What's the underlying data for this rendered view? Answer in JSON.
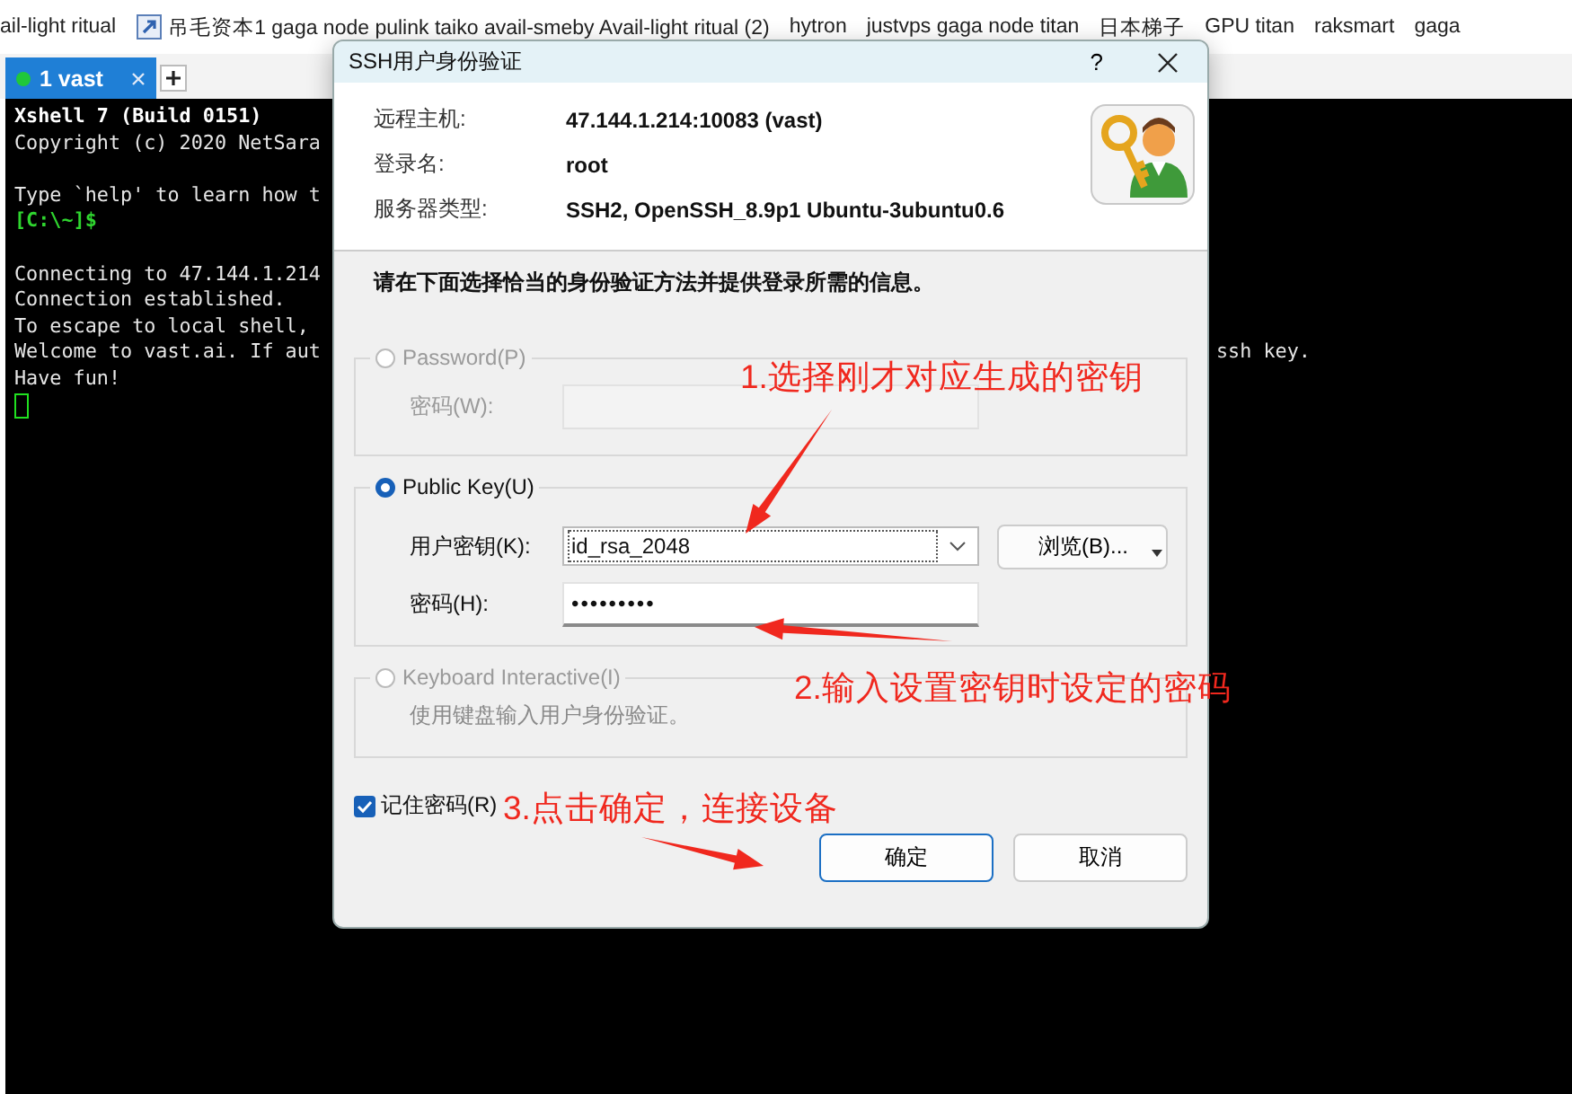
{
  "bookmarks": [
    {
      "label": "ail-light ritual",
      "has_icon": false
    },
    {
      "label": "吊毛资本1 gaga node pulink taiko avail-smeby Avail-light ritual (2)",
      "has_icon": true
    },
    {
      "label": "hytron",
      "has_icon": false
    },
    {
      "label": "justvps gaga node titan",
      "has_icon": false
    },
    {
      "label": "日本梯子",
      "has_icon": false
    },
    {
      "label": "GPU titan",
      "has_icon": false
    },
    {
      "label": "raksmart",
      "has_icon": false
    },
    {
      "label": "gaga",
      "has_icon": false
    }
  ],
  "tabs": [
    {
      "label": "1 vast",
      "selected": true,
      "connected": true
    }
  ],
  "terminal": [
    {
      "kind": "bold",
      "text": "Xshell 7 (Build 0151)"
    },
    {
      "kind": "normal",
      "text": "Copyright (c) 2020 NetSara"
    },
    {
      "kind": "blank"
    },
    {
      "kind": "normal",
      "text": "Type `help' to learn how t"
    },
    {
      "kind": "prompt",
      "text": "[C:\\~]$"
    },
    {
      "kind": "blank"
    },
    {
      "kind": "normal",
      "text": "Connecting to 47.144.1.214"
    },
    {
      "kind": "normal",
      "text": "Connection established."
    },
    {
      "kind": "normal",
      "text": "To escape to local shell,"
    },
    {
      "kind": "normal",
      "text": "Welcome to vast.ai. If aut",
      "tail": "ssh key."
    },
    {
      "kind": "normal",
      "text": "Have fun!"
    },
    {
      "kind": "cursor"
    }
  ],
  "dialog": {
    "title": "SSH用户身份验证",
    "help_button": "?",
    "info": [
      {
        "label": "远程主机:",
        "value": "47.144.1.214:10083 (vast)"
      },
      {
        "label": "登录名:",
        "value": "root"
      },
      {
        "label": "服务器类型:",
        "value": "SSH2, OpenSSH_8.9p1 Ubuntu-3ubuntu0.6"
      }
    ],
    "instruction": "请在下面选择恰当的身份验证方法并提供登录所需的信息。",
    "methods": [
      {
        "kind": "password",
        "label": "Password(P)",
        "selected": false,
        "disabled": true,
        "fields": [
          {
            "kind": "text",
            "label": "密码(W):"
          }
        ]
      },
      {
        "kind": "publickey",
        "label": "Public Key(U)",
        "selected": true,
        "disabled": false,
        "fields": [
          {
            "kind": "combo",
            "label": "用户密钥(K):",
            "value": "id_rsa_2048"
          },
          {
            "kind": "text",
            "label": "密码(H):",
            "value": "•••••••••"
          }
        ],
        "browse_button": "浏览(B)..."
      },
      {
        "kind": "keyboard",
        "label": "Keyboard Interactive(I)",
        "selected": false,
        "disabled": true,
        "description": "使用键盘输入用户身份验证。"
      }
    ],
    "remember": {
      "label": "记住密码(R)",
      "checked": true
    },
    "buttons": [
      {
        "label": "确定",
        "default": true
      },
      {
        "label": "取消",
        "default": false
      }
    ]
  },
  "annotations": [
    {
      "text": "1.选择刚才对应生成的密钥"
    },
    {
      "text": "2.输入设置密钥时设定的密码"
    },
    {
      "text": "3.点击确定，连接设备"
    }
  ]
}
